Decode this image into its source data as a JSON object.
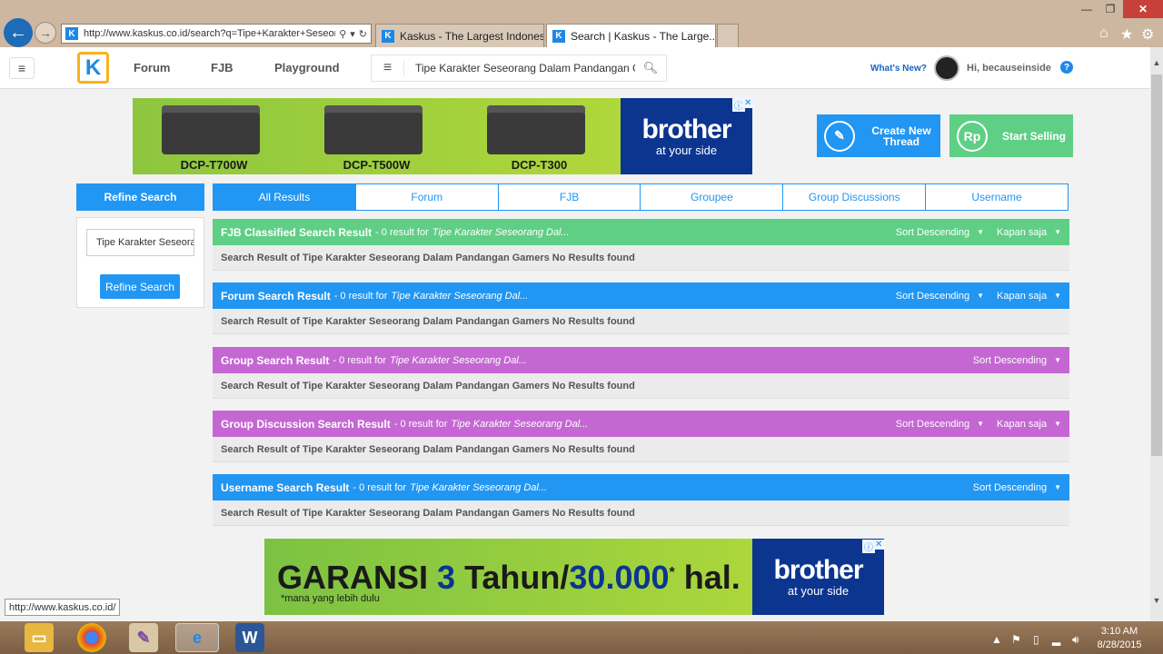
{
  "browser": {
    "address": "http://www.kaskus.co.id/search?q=Tipe+Karakter+Seseorang",
    "tabs": [
      {
        "label": "Kaskus - The Largest Indonesia..."
      },
      {
        "label": "Search | Kaskus - The Large..."
      }
    ],
    "status_url": "http://www.kaskus.co.id/"
  },
  "header": {
    "nav": [
      "Forum",
      "FJB",
      "Playground"
    ],
    "search_value": "Tipe Karakter Seseorang Dalam Pandangan Gam",
    "whats_new": "What's New?",
    "greeting": "Hi, becauseinside",
    "help": "?"
  },
  "ad_top": {
    "models": [
      "DCP-T700W",
      "DCP-T500W",
      "DCP-T300"
    ],
    "brand": "brother",
    "tagline": "at your side"
  },
  "actions": {
    "create_line1": "Create New",
    "create_line2": "Thread",
    "sell": "Start Selling",
    "sell_icon": "Rp"
  },
  "refine": {
    "heading": "Refine Search",
    "input_value": "Tipe Karakter Seseorang",
    "button": "Refine Search"
  },
  "tabs": [
    "All Results",
    "Forum",
    "FJB",
    "Groupee",
    "Group Discussions",
    "Username"
  ],
  "sections": [
    {
      "title": "FJB Classified Search Result",
      "info": "- 0 result for",
      "query": "Tipe Karakter Seseorang Dal...",
      "sort": "Sort Descending",
      "time": "Kapan saja",
      "body": "Search Result of Tipe Karakter Seseorang Dalam Pandangan Gamers No Results found"
    },
    {
      "title": "Forum Search Result",
      "info": "- 0 result for",
      "query": "Tipe Karakter Seseorang Dal...",
      "sort": "Sort Descending",
      "time": "Kapan saja",
      "body": "Search Result of Tipe Karakter Seseorang Dalam Pandangan Gamers No Results found"
    },
    {
      "title": "Group Search Result",
      "info": "- 0 result for",
      "query": "Tipe Karakter Seseorang Dal...",
      "sort": "Sort Descending",
      "body": "Search Result of Tipe Karakter Seseorang Dalam Pandangan Gamers No Results found"
    },
    {
      "title": "Group Discussion Search Result",
      "info": "- 0 result for",
      "query": "Tipe Karakter Seseorang Dal...",
      "sort": "Sort Descending",
      "time": "Kapan saja",
      "body": "Search Result of Tipe Karakter Seseorang Dalam Pandangan Gamers No Results found"
    },
    {
      "title": "Username Search Result",
      "info": "- 0 result for",
      "query": "Tipe Karakter Seseorang Dal...",
      "sort": "Sort Descending",
      "body": "Search Result of Tipe Karakter Seseorang Dalam Pandangan Gamers No Results found"
    }
  ],
  "ad_bottom": {
    "word1": "GARANSI",
    "num1": "3",
    "word2": "Tahun",
    "slash": "/",
    "num2": "30.000",
    "star": "*",
    "word3": "hal.",
    "note": "*mana yang lebih dulu",
    "brand": "brother",
    "tagline": "at your side"
  },
  "taskbar": {
    "time": "3:10 AM",
    "date": "8/28/2015"
  },
  "colors": {
    "primary": "#2196f3",
    "fjb_green": "#5fcf86",
    "group_purple": "#c567d3",
    "brand_blue": "#0c3590"
  }
}
